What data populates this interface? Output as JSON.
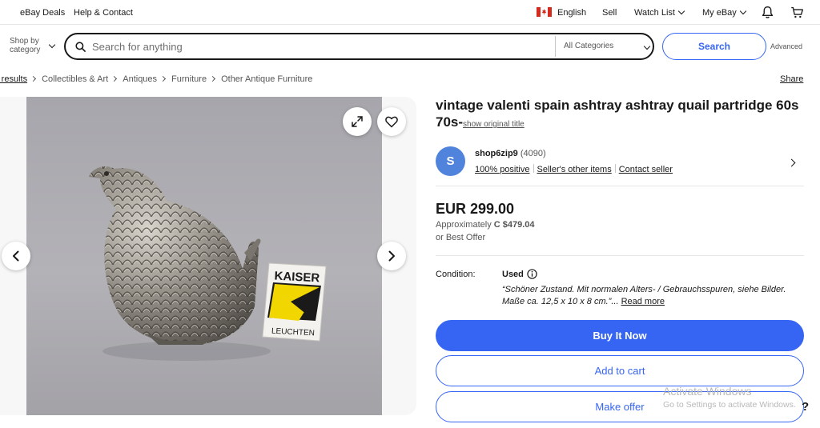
{
  "topbar": {
    "deals": "eBay Deals",
    "help": "Help & Contact",
    "language": "English",
    "sell": "Sell",
    "watchlist": "Watch List",
    "myebay": "My eBay",
    "icons": [
      "canada-flag",
      "bell-icon",
      "cart-icon"
    ]
  },
  "search": {
    "shop_by_line1": "Shop by",
    "shop_by_line2": "category",
    "placeholder": "Search for anything",
    "category": "All Categories",
    "button": "Search",
    "advanced": "Advanced"
  },
  "breadcrumb": {
    "first": "ch results",
    "items": [
      "Collectibles & Art",
      "Antiques",
      "Furniture",
      "Other Antique Furniture"
    ],
    "share": "Share"
  },
  "photo": {
    "box_text_top": "KAISER",
    "box_text_bottom": "LEUCHTEN"
  },
  "listing": {
    "title": "vintage valenti spain ashtray ashtray quail partridge 60s 70s-",
    "show_original": "show original title",
    "seller": {
      "initial": "S",
      "name": "shop6zip9",
      "feedback": "(4090)",
      "positive": "100% positive",
      "other_items": "Seller's other items",
      "contact": "Contact seller"
    },
    "price": "EUR 299.00",
    "approx_label": "Approximately",
    "approx_value": "C $479.04",
    "best_offer": "or Best Offer",
    "condition_label": "Condition:",
    "condition_value": "Used",
    "condition_desc": "“Schöner Zustand. Mit normalen Alters- / Gebrauchsspuren, siehe Bilder. Maße ca. 12,5 x 10 x 8 cm.”...",
    "read_more": "Read more",
    "buy_now": "Buy It Now",
    "add_to_cart": "Add to cart",
    "make_offer": "Make offer"
  },
  "os_overlay": {
    "watermark_title": "Activate Windows",
    "watermark_sub": "Go to Settings to activate Windows.",
    "help": "?"
  },
  "colors": {
    "accent": "#3665f3",
    "avatar": "#5083dc",
    "box_yellow": "#f2d600"
  }
}
